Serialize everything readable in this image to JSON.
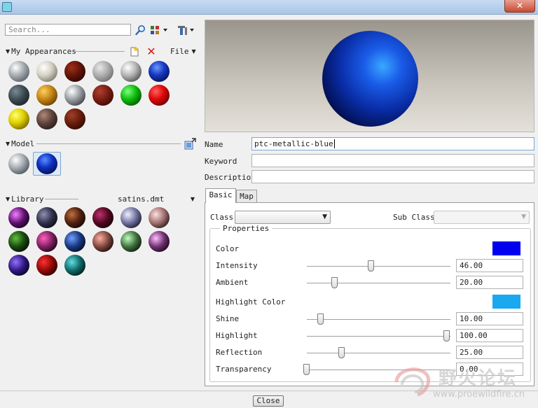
{
  "window": {
    "close_glyph": "✕"
  },
  "left": {
    "search": {
      "placeholder": "Search..."
    },
    "my_appearances": {
      "title": "My Appearances",
      "file_menu": "File",
      "balls": [
        "radial-gradient(circle at 35% 32%, #ffffff, #a8aeb4 40%, #4a5058 90%)",
        "radial-gradient(circle at 35% 32%, #ffffff, #d6d2c4 40%, #6a665c 90%)",
        "radial-gradient(circle at 35% 32%, #a03018, #581008 50%, #200400 90%)",
        "radial-gradient(circle at 35% 32%, #e8e8e8, #a8a8a8 45%, #606060 90%)",
        "radial-gradient(circle at 35% 32%, #ffffff, #b8b8b8 40%, #3c3c3c 90%)",
        "radial-gradient(circle at 40% 32%, #6a9aff, #1838c0 40%, #020a40 90%)",
        "radial-gradient(circle at 35% 32%, #7a8a94, #3a4850 45%, #121a20 90%)",
        "radial-gradient(circle at 35% 32%, #ffd060, #c88818 40%, #503000 90%)",
        "radial-gradient(circle at 35% 32%, #ffffff, #a0a4a8 40%, #2a2e32 90%)",
        "radial-gradient(circle at 35% 32%, #b04030, #701810 50%, #300400 90%)",
        "radial-gradient(circle at 35% 32%, #80ff80, #10c010 40%, #004000 90%)",
        "radial-gradient(circle at 35% 32%, #ff6060, #e00808 40%, #500000 90%)",
        "radial-gradient(circle at 35% 32%, #ffff70, #e0d000 40%, #605000 90%)",
        "radial-gradient(circle at 35% 32%, #b08878, #5a4038 45%, #201410 90%)",
        "radial-gradient(circle at 35% 32%, #a04028, #601808 50%, #200800 90%)"
      ]
    },
    "model": {
      "title": "Model",
      "balls": [
        "radial-gradient(circle at 35% 32%, #ffffff, #a8aeb4 40%, #3a4048 90%)",
        "radial-gradient(circle at 40% 32%, #5a90ff, #1030c0 40%, #020838 90%)"
      ]
    },
    "library": {
      "title": "Library",
      "file": "satins.dmt",
      "balls": [
        "radial-gradient(circle at 35% 35%, #f080ff, #601070 45%, #0c0010 85%)",
        "radial-gradient(circle at 35% 35%, #9090b8, #303048 45%, #060610 85%)",
        "radial-gradient(circle at 35% 35%, #c07040, #502010 45%, #100400 85%)",
        "radial-gradient(circle at 35% 35%, #c03070, #500820 45%, #100004 85%)",
        "radial-gradient(circle at 35% 35%, #f0f0ff, #7070a0 45%, #101020 85%)",
        "radial-gradient(circle at 35% 35%, #ffe0e0, #a07070 45%, #201010 85%)",
        "radial-gradient(circle at 35% 35%, #60c040, #184810 45%, #020800 85%)",
        "radial-gradient(circle at 35% 35%, #ff60c0, #802060 45%, #100008 85%)",
        "radial-gradient(circle at 35% 35%, #70a0ff, #183880 45%, #020818 85%)",
        "radial-gradient(circle at 35% 35%, #ffb0a0, #804840 45%, #100404 85%)",
        "radial-gradient(circle at 35% 35%, #c0ffc0, #407040 45%, #041004 85%)",
        "radial-gradient(circle at 35% 35%, #ffc0ff, #703070 45%, #100410 85%)",
        "radial-gradient(circle at 35% 35%, #9070ff, #301880 45%, #040018 85%)",
        "radial-gradient(circle at 35% 35%, #ff3030, #900808 45%, #180000 85%)",
        "radial-gradient(circle at 35% 35%, #60e0e0, #106868 45%, #001010 85%)"
      ]
    }
  },
  "right": {
    "name_label": "Name",
    "name_value": "ptc-metallic-blue",
    "keyword_label": "Keyword",
    "keyword_value": "",
    "description_label": "Description",
    "description_value": "",
    "tabs": [
      {
        "label": "Basic",
        "active": true
      },
      {
        "label": "Map",
        "active": false
      }
    ],
    "class_label": "Class",
    "class_value": "",
    "subclass_label": "Sub Class",
    "subclass_value": "",
    "properties_title": "Properties",
    "color_label": "Color",
    "color_value": "#0000ee",
    "highlight_color_label": "Highlight Color",
    "highlight_color_value": "#1aa8f0",
    "sliders": [
      {
        "label": "Intensity",
        "value": "46.00",
        "fraction": 0.46
      },
      {
        "label": "Ambient",
        "value": "20.00",
        "fraction": 0.2
      },
      {
        "label": "Shine",
        "value": "10.00",
        "fraction": 0.1
      },
      {
        "label": "Highlight",
        "value": "100.00",
        "fraction": 1.0
      },
      {
        "label": "Reflection",
        "value": "25.00",
        "fraction": 0.25
      },
      {
        "label": "Transparency",
        "value": "0.00",
        "fraction": 0.0
      }
    ]
  },
  "footer": {
    "close_label": "Close"
  },
  "watermark": {
    "text": "野火论坛",
    "url": "www.proewildfire.cn"
  }
}
